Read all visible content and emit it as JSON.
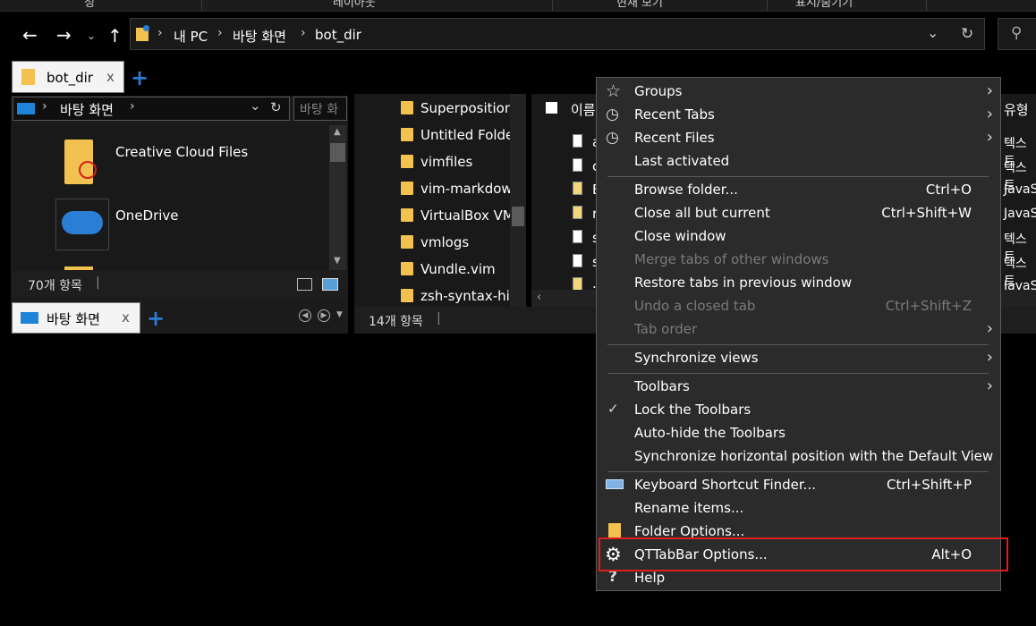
{
  "ribbon": {
    "items": [
      "정",
      "레이아웃",
      "현재 보기",
      "표시/숨기기"
    ]
  },
  "nav": {
    "back_icon": "back-arrow-icon",
    "forward_icon": "forward-arrow-icon",
    "up_icon": "up-arrow-icon",
    "breadcrumb": [
      "내 PC",
      "바탕 화면",
      "bot_dir"
    ]
  },
  "tabs": {
    "top_tab_label": "bot_dir",
    "top_tab_close": "x",
    "bottom_tab_label": "바탕 화면",
    "bottom_tab_close": "x"
  },
  "left_pane": {
    "path_label": "바탕 화면",
    "search_placeholder": "바탕 화",
    "items": [
      {
        "name": "Creative Cloud Files"
      },
      {
        "name": "OneDrive"
      }
    ],
    "status": "70개 항목"
  },
  "middle_pane": {
    "items": [
      "Superposition",
      "Untitled Folder",
      "vimfiles",
      "vim-markdown",
      "VirtualBox VMs",
      "vmlogs",
      "Vundle.vim",
      "zsh-syntax-hig"
    ],
    "status": "14개 항목"
  },
  "right_pane": {
    "col_name": "이름",
    "col_type": "유형",
    "file_initials": [
      "a",
      "c",
      "E",
      "r",
      "s",
      "s",
      "."
    ],
    "types": [
      "텍스트",
      "텍스트",
      "JavaS",
      "JavaS",
      "텍스트",
      "텍스트",
      "JavaS"
    ]
  },
  "menu": {
    "groups": "Groups",
    "recent_tabs": "Recent Tabs",
    "recent_files": "Recent Files",
    "last_activated": "Last activated",
    "browse_folder": "Browse folder...",
    "browse_folder_sc": "Ctrl+O",
    "close_all_but_current": "Close all but current",
    "close_all_but_current_sc": "Ctrl+Shift+W",
    "close_window": "Close window",
    "merge_tabs": "Merge tabs of other windows",
    "restore_tabs": "Restore tabs in previous window",
    "undo_closed_tab": "Undo a closed tab",
    "undo_closed_tab_sc": "Ctrl+Shift+Z",
    "tab_order": "Tab order",
    "synchronize_views": "Synchronize views",
    "toolbars": "Toolbars",
    "lock_toolbars": "Lock the Toolbars",
    "auto_hide_toolbars": "Auto-hide the Toolbars",
    "sync_horizontal": "Synchronize horizontal position with the Default View",
    "keyboard_shortcut_finder": "Keyboard Shortcut Finder...",
    "keyboard_shortcut_finder_sc": "Ctrl+Shift+P",
    "rename_items": "Rename items...",
    "folder_options": "Folder Options...",
    "qttabbar_options": "QTTabBar Options...",
    "qttabbar_options_sc": "Alt+O",
    "help": "Help"
  },
  "colors": {
    "highlight_box": "#e01e1e",
    "accent": "#2b7bd6"
  }
}
